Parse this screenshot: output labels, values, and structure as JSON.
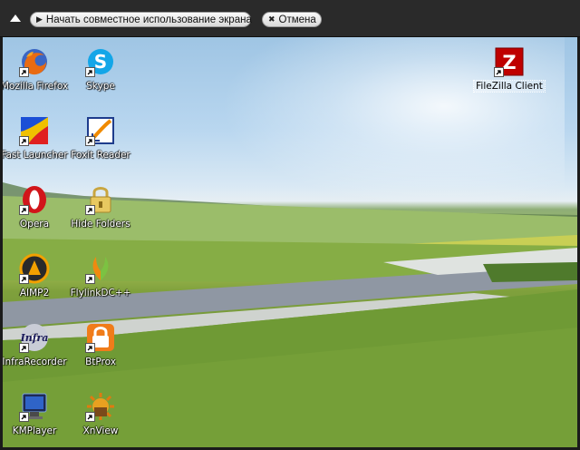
{
  "sharebar": {
    "share_label": "Начать совместное использование экрана",
    "cancel_label": "Отмена"
  },
  "desktop": {
    "icons": [
      {
        "label": "Mozilla Firefox",
        "icon": "firefox-icon"
      },
      {
        "label": "Skype",
        "icon": "skype-icon"
      },
      {
        "label": "Fast Launcher",
        "icon": "fast-launcher-icon"
      },
      {
        "label": "Foxit Reader",
        "icon": "foxit-reader-icon"
      },
      {
        "label": "Opera",
        "icon": "opera-icon"
      },
      {
        "label": "Hide Folders",
        "icon": "hide-folders-icon"
      },
      {
        "label": "AIMP2",
        "icon": "aimp2-icon"
      },
      {
        "label": "FlylinkDC++",
        "icon": "flylinkdc-icon"
      },
      {
        "label": "InfraRecorder",
        "icon": "infrarecorder-icon"
      },
      {
        "label": "BtProx",
        "icon": "btprox-icon"
      },
      {
        "label": "KMPlayer",
        "icon": "kmplayer-icon"
      },
      {
        "label": "XnView",
        "icon": "xnview-icon"
      },
      {
        "label": "FileZilla Client",
        "icon": "filezilla-icon",
        "selected": true
      }
    ]
  }
}
